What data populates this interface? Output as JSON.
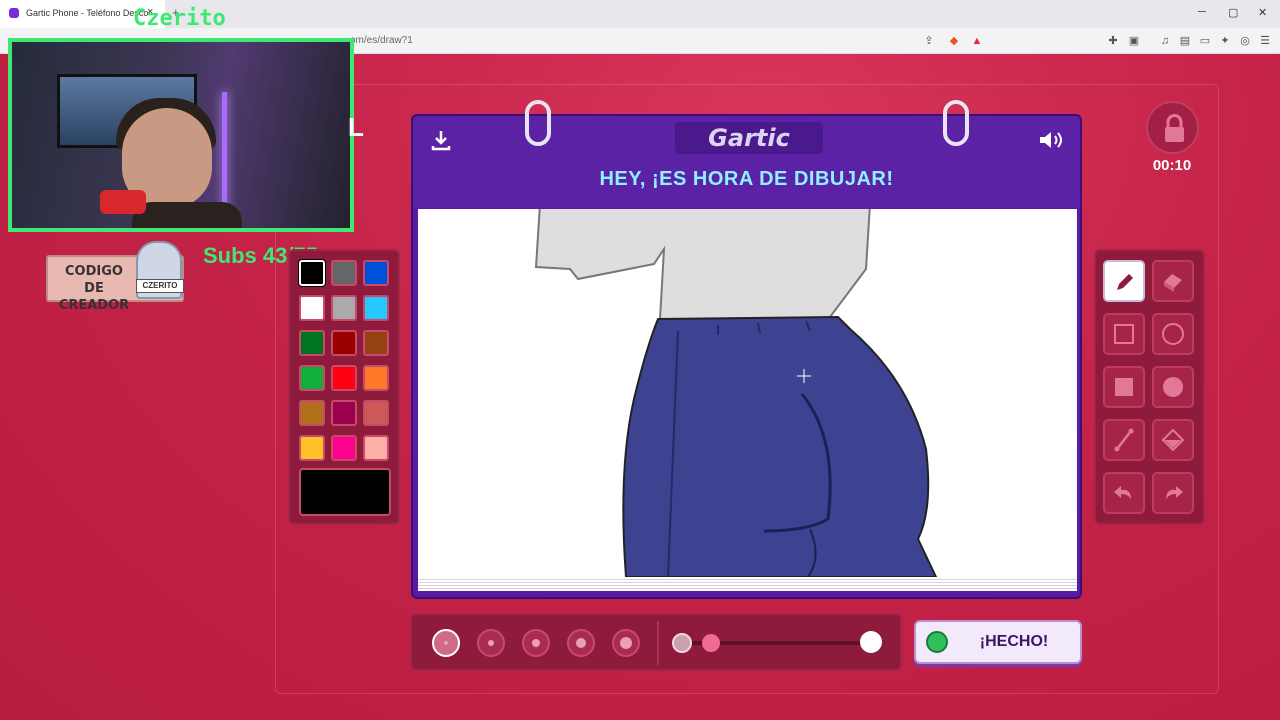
{
  "browser": {
    "tab_title": "Gartic Phone - Teléfono Desco",
    "tab_close": "×",
    "new_tab": "+",
    "url": "om/es/draw?1",
    "window": {
      "min": "─",
      "max": "▢",
      "close": "✕"
    }
  },
  "overlay": {
    "streamer_name": "Czerito",
    "creator_code": "CODIGO DE CREADOR",
    "creator_tag": "CZERITO",
    "subs": "Subs 43/75"
  },
  "game": {
    "logo": "Gartic",
    "prompt": "HEY, ¡ES HORA DE DIBUJAR!",
    "timer": "00:10",
    "done_label": "¡HECHO!",
    "partial_letter": "L"
  },
  "palette": {
    "colors": [
      "#000000",
      "#666666",
      "#0050dc",
      "#ffffff",
      "#aaaaaa",
      "#26c9ff",
      "#017420",
      "#990000",
      "#964112",
      "#11b03c",
      "#ff0013",
      "#ff7829",
      "#b0701c",
      "#99004e",
      "#cb5a57",
      "#ffc126",
      "#ff008f",
      "#feafa8"
    ],
    "selected": "#000000",
    "current": "#000000"
  },
  "tools": [
    "pencil-icon",
    "eraser-icon",
    "square-outline-icon",
    "circle-outline-icon",
    "square-filled-icon",
    "circle-filled-icon",
    "line-icon",
    "fill-bucket-icon",
    "undo-icon",
    "redo-icon"
  ],
  "brush_sizes": [
    1,
    2,
    3,
    4,
    5
  ],
  "selected_size": 1,
  "opacity_fraction": 0.15
}
